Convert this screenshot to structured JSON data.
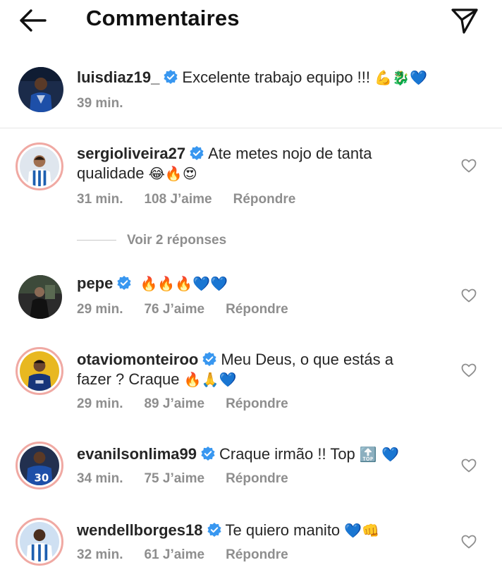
{
  "header": {
    "title": "Commentaires"
  },
  "caption": {
    "username": "luisdiaz19_",
    "text": "Excelente trabajo equipo !!!",
    "emojis": "💪🐉💙",
    "time": "39 min."
  },
  "comments": [
    {
      "username": "sergioliveira27",
      "text_line1": "Ate metes nojo de tanta",
      "text_line2": "qualidade",
      "emojis": "😂🔥😍",
      "time": "31 min.",
      "likes": "108 J’aime",
      "reply": "Répondre"
    },
    {
      "username": "pepe",
      "text": "",
      "emojis": "🔥🔥🔥💙💙",
      "time": "29 min.",
      "likes": "76 J’aime",
      "reply": "Répondre"
    },
    {
      "username": "otaviomonteiroo",
      "text_line1": "Meu Deus, o que estás a",
      "text_line2": "fazer ? Craque",
      "emojis": "🔥🙏💙",
      "time": "29 min.",
      "likes": "89 J’aime",
      "reply": "Répondre"
    },
    {
      "username": "evanilsonlima99",
      "text": "Craque irmão !! Top",
      "emojis": "🔝 💙",
      "time": "34 min.",
      "likes": "75 J’aime",
      "reply": "Répondre"
    },
    {
      "username": "wendellborges18",
      "text": "Te quiero manito",
      "emojis": "💙👊",
      "time": "32 min.",
      "likes": "61 J’aime",
      "reply": "Répondre"
    }
  ],
  "view_replies": "Voir 2 réponses",
  "colors": {
    "verified": "#3897f0",
    "muted": "#8e8e8e",
    "ring": "#f0a9a3"
  },
  "icons": {
    "back": "arrow-left-icon",
    "send": "paper-plane-icon",
    "like": "heart-outline-icon",
    "verified": "verified-badge-icon"
  }
}
